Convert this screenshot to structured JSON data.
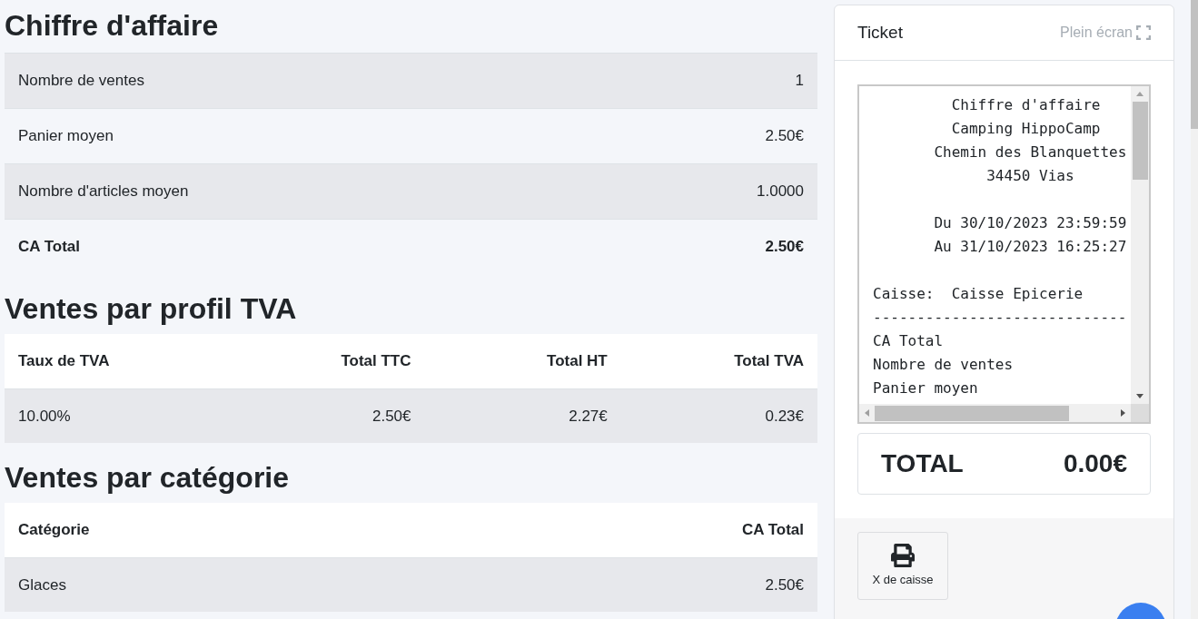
{
  "summary": {
    "title": "Chiffre d'affaire",
    "rows": [
      {
        "label": "Nombre de ventes",
        "value": "1",
        "kind": "normal"
      },
      {
        "label": "Panier moyen",
        "value": "2.50€",
        "kind": "normal"
      },
      {
        "label": "Nombre d'articles moyen",
        "value": "1.0000",
        "kind": "normal"
      },
      {
        "label": "CA Total",
        "value": "2.50€",
        "kind": "total"
      }
    ]
  },
  "vat_table": {
    "title": "Ventes par profil TVA",
    "columns": [
      "Taux de TVA",
      "Total TTC",
      "Total HT",
      "Total TVA"
    ],
    "rows": [
      [
        "10.00%",
        "2.50€",
        "2.27€",
        "0.23€"
      ]
    ]
  },
  "category_table": {
    "title": "Ventes par catégorie",
    "columns": [
      "Catégorie",
      "CA Total"
    ],
    "rows": [
      [
        "Glaces",
        "2.50€"
      ]
    ]
  },
  "ticket": {
    "title": "Ticket",
    "fullscreen_label": "Plein écran",
    "blocks": [
      {
        "lines": [
          "         Chiffre d'affaire",
          "         Camping HippoCamp",
          "       Chemin des Blanquettes",
          "             34450 Vias"
        ]
      },
      {
        "lines": [
          "       Du 30/10/2023 23:59:59",
          "       Au 31/10/2023 16:25:27"
        ]
      },
      {
        "lines": [
          "Caisse:  Caisse Epicerie",
          "-----------------------------",
          "CA Total",
          "Nombre de ventes",
          "Panier moyen"
        ]
      }
    ],
    "total_label": "TOTAL",
    "total_value": "0.00€",
    "actions": [
      {
        "label": "X de caisse"
      }
    ]
  }
}
